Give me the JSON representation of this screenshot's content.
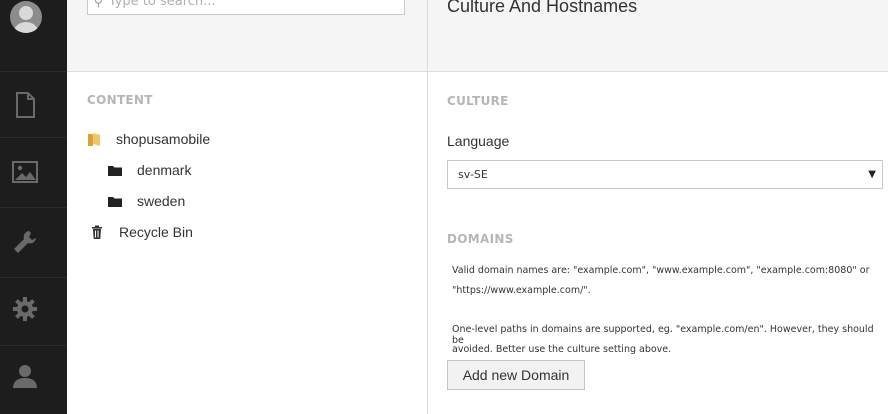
{
  "nav": {
    "items": [
      {
        "name": "content-section-icon"
      },
      {
        "name": "media-section-icon"
      },
      {
        "name": "settings-section-icon"
      },
      {
        "name": "developer-section-icon"
      },
      {
        "name": "users-section-icon"
      }
    ]
  },
  "search": {
    "placeholder": "Type to search..."
  },
  "tree": {
    "section_label": "CONTENT",
    "nodes": [
      {
        "label": "shopusamobile",
        "icon": "folder-yellow-icon"
      },
      {
        "label": "denmark",
        "icon": "folder-icon"
      },
      {
        "label": "sweden",
        "icon": "folder-icon"
      },
      {
        "label": "Recycle Bin",
        "icon": "trash-icon"
      }
    ]
  },
  "dialog": {
    "title": "Culture And Hostnames",
    "culture_label": "CULTURE",
    "language_label": "Language",
    "language_value": "sv-SE",
    "domains_label": "DOMAINS",
    "help1_line1": "Valid domain names are: \"example.com\", \"www.example.com\", \"example.com:8080\" or",
    "help1_line2": "\"https://www.example.com/\".",
    "help2_line1": "One-level paths in domains are supported, eg. \"example.com/en\". However, they should be",
    "help2_line2": "avoided. Better use the culture setting above.",
    "add_domain_button": "Add new Domain"
  },
  "colors": {
    "sidebar": "#1d1d1d",
    "panel": "#f5f5f5",
    "folder": "#e8b84a"
  }
}
